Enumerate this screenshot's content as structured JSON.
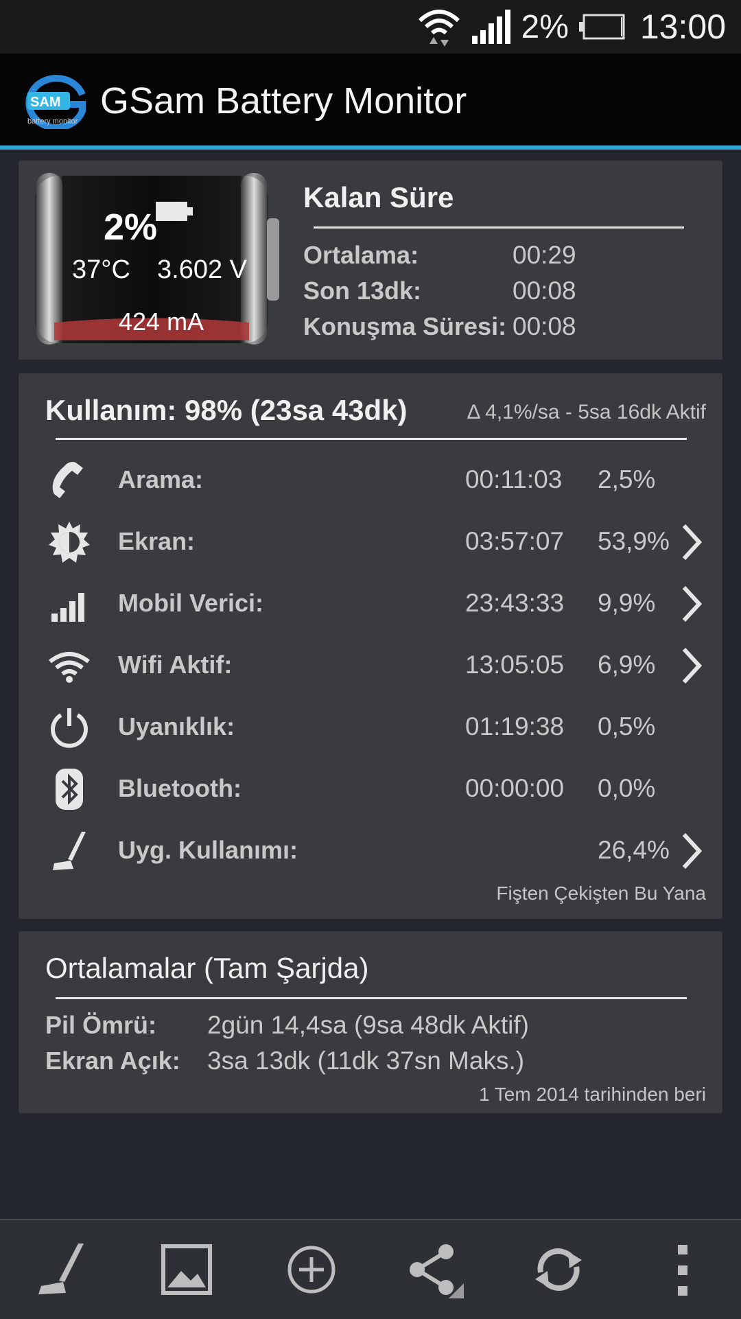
{
  "status_bar": {
    "battery_percent": "2%",
    "time": "13:00"
  },
  "app": {
    "title": "GSam Battery Monitor",
    "logo_text": "SAM",
    "logo_subtext": "battery monitor"
  },
  "battery_card": {
    "percent": "2%",
    "temperature": "37°C",
    "voltage": "3.602 V",
    "current": "424 mA",
    "level_fraction": 0.02,
    "remaining_title": "Kalan Süre",
    "rows": [
      {
        "label": "Ortalama:",
        "value": "00:29"
      },
      {
        "label": "Son 13dk:",
        "value": "00:08"
      },
      {
        "label": "Konuşma Süresi:",
        "value": "00:08"
      }
    ]
  },
  "usage_card": {
    "title": "Kullanım: 98% (23sa 43dk)",
    "rate": "Δ 4,1%/sa - 5sa 16dk Aktif",
    "rows": [
      {
        "icon": "phone-icon",
        "label": "Arama:",
        "duration": "00:11:03",
        "percent": "2,5%",
        "has_chevron": false
      },
      {
        "icon": "brightness-icon",
        "label": "Ekran:",
        "duration": "03:57:07",
        "percent": "53,9%",
        "has_chevron": true
      },
      {
        "icon": "signal-icon",
        "label": "Mobil Verici:",
        "duration": "23:43:33",
        "percent": "9,9%",
        "has_chevron": true
      },
      {
        "icon": "wifi-icon",
        "label": "Wifi Aktif:",
        "duration": "13:05:05",
        "percent": "6,9%",
        "has_chevron": true
      },
      {
        "icon": "power-icon",
        "label": "Uyanıklık:",
        "duration": "01:19:38",
        "percent": "0,5%",
        "has_chevron": false
      },
      {
        "icon": "bluetooth-icon",
        "label": "Bluetooth:",
        "duration": "00:00:00",
        "percent": "0,0%",
        "has_chevron": false
      },
      {
        "icon": "broom-icon",
        "label": "Uyg. Kullanımı:",
        "duration": "",
        "percent": "26,4%",
        "has_chevron": true
      }
    ],
    "footnote": "Fişten Çekişten Bu Yana"
  },
  "averages_card": {
    "title": "Ortalamalar (Tam Şarjda)",
    "rows": [
      {
        "label": "Pil Ömrü:",
        "value": "2gün 14,4sa (9sa 48dk Aktif)"
      },
      {
        "label": "Ekran Açık:",
        "value": "3sa 13dk (11dk 37sn Maks.)"
      }
    ],
    "footnote": "1 Tem 2014 tarihinden beri"
  },
  "bottom_bar": {
    "buttons": [
      "app-usage-icon",
      "image-icon",
      "add-icon",
      "share-icon",
      "refresh-icon",
      "overflow-menu-icon"
    ]
  },
  "colors": {
    "accent": "#33a6d6",
    "card": "#3a3b3f",
    "background": "#23272d",
    "battery_fill": "#b23a3a"
  }
}
